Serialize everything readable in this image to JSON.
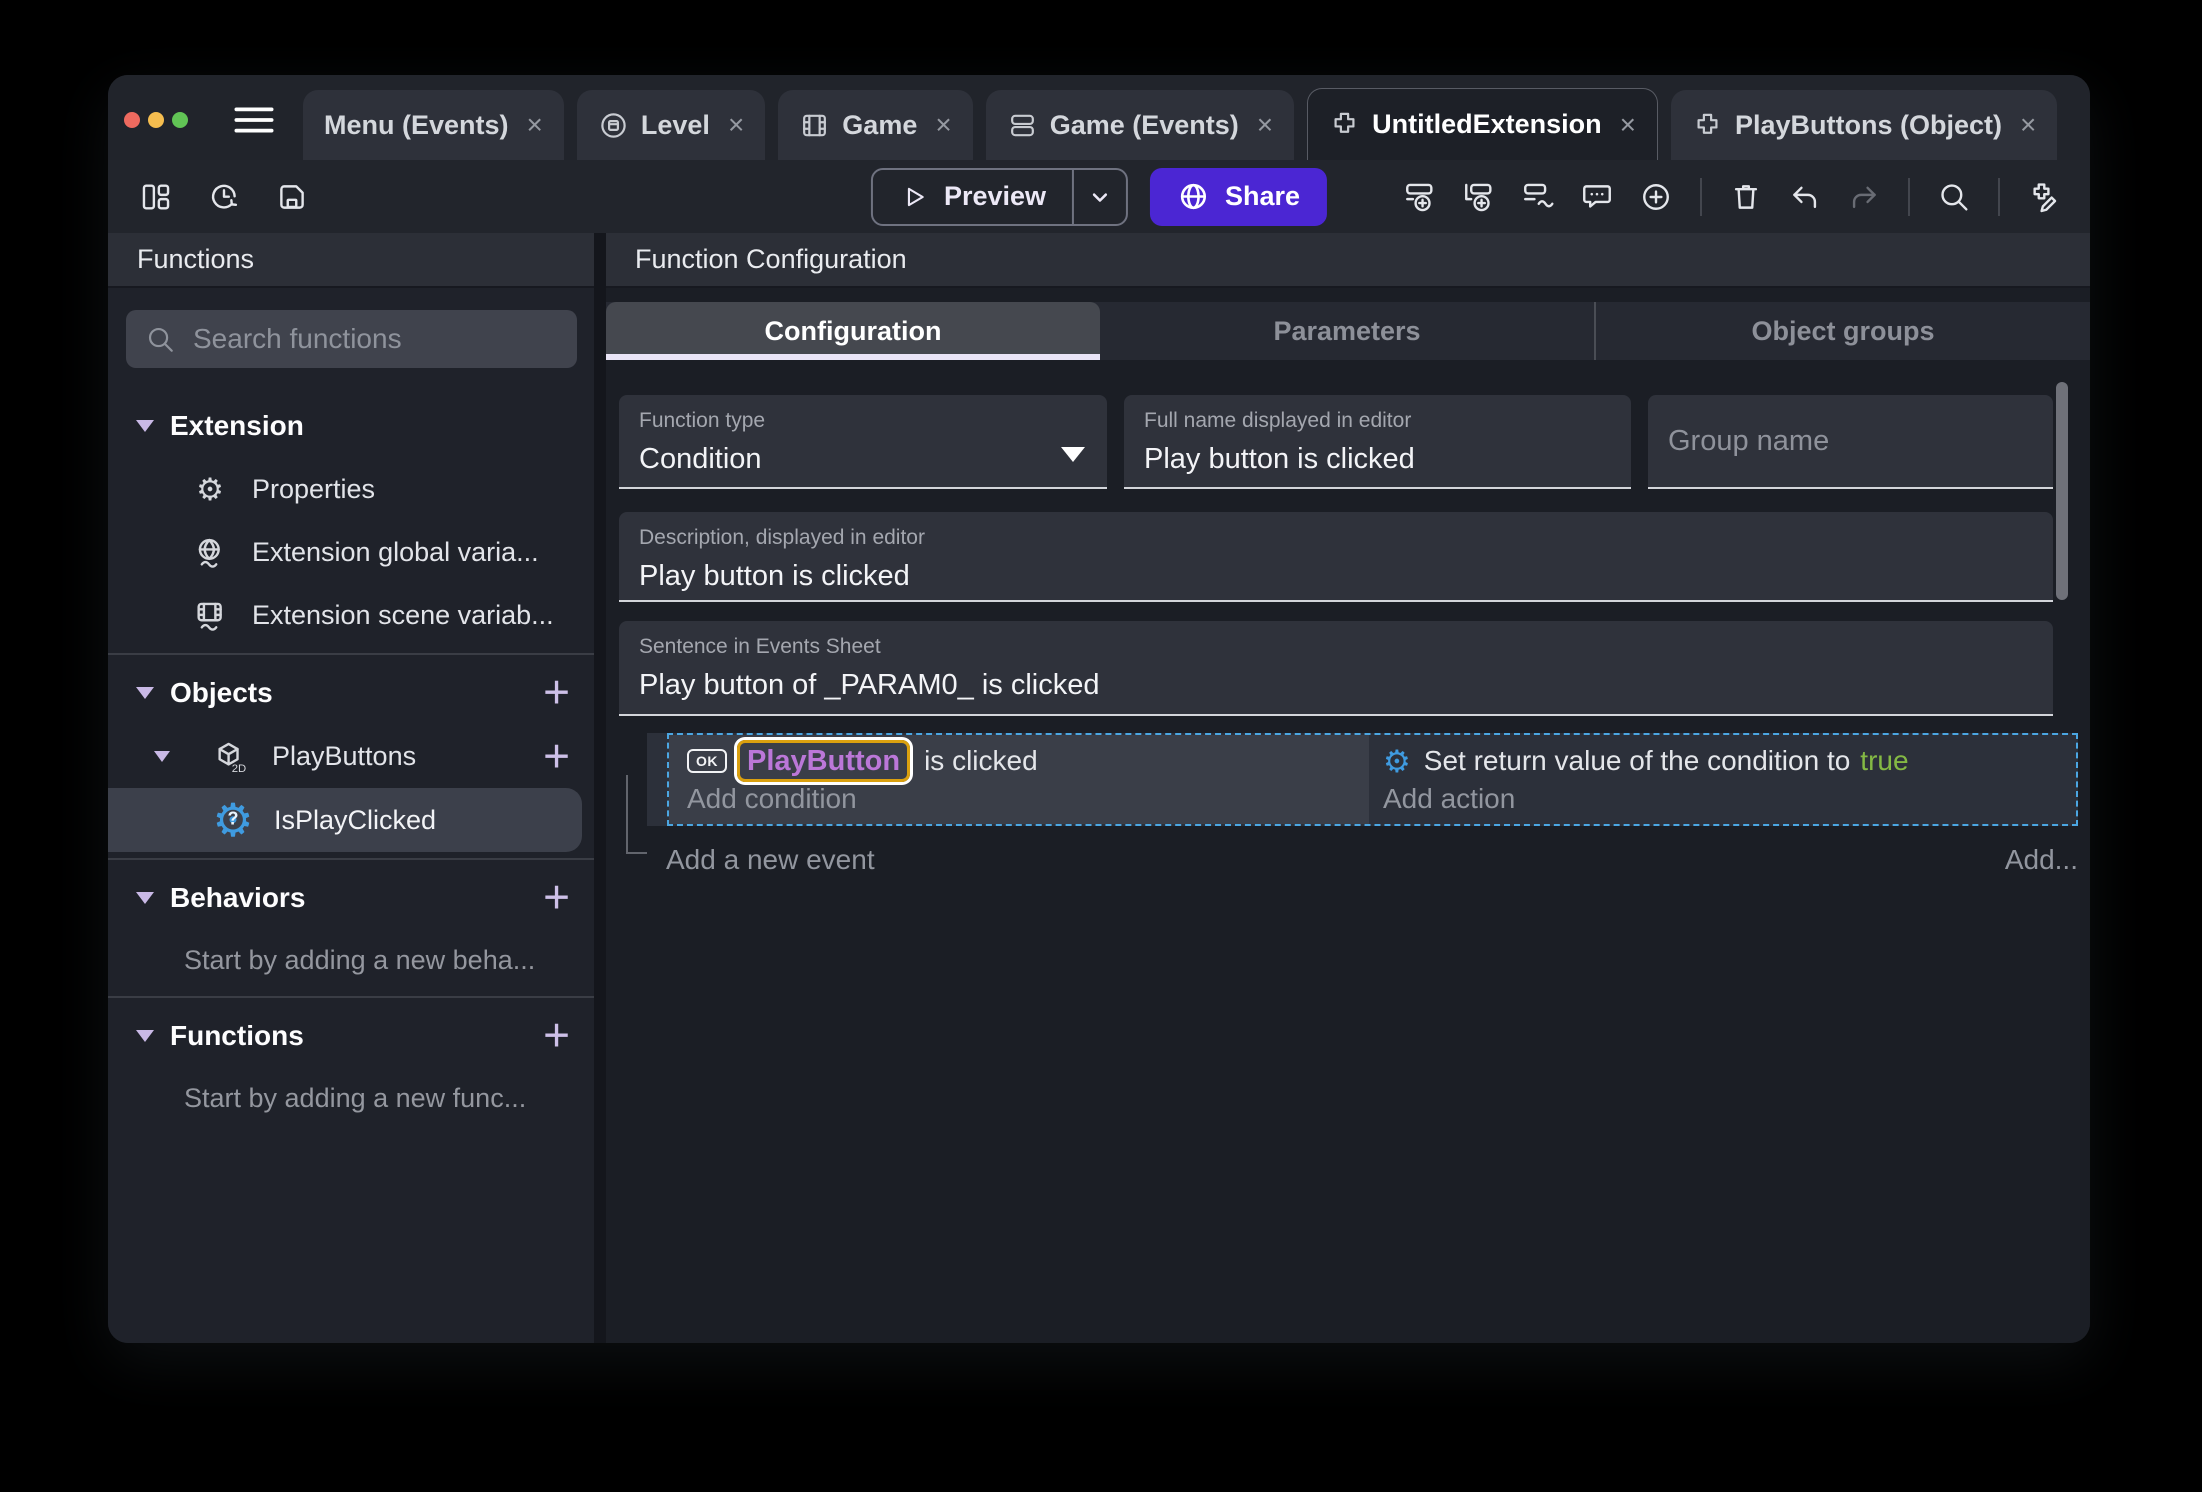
{
  "colors": {
    "accent_purple": "#4b26d3",
    "selection_blue": "#4ba6e2",
    "object_chip_text": "#bb77d8",
    "object_chip_border": "#daa00f",
    "true_green": "#84b944",
    "traffic_red": "#ee6a5f",
    "traffic_yellow": "#f5bd4f",
    "traffic_green": "#61c455"
  },
  "icons": {
    "gear_glyph": "⚙",
    "function_icon_glyph": "?"
  },
  "titlebar": {
    "close_glyph": "×",
    "tabs": [
      {
        "label": "Menu (Events)",
        "icon": null,
        "active": false
      },
      {
        "label": "Level",
        "icon": "scene-icon",
        "active": false
      },
      {
        "label": "Game",
        "icon": "video-icon",
        "active": false
      },
      {
        "label": "Game (Events)",
        "icon": "events-sheet-icon",
        "active": false
      },
      {
        "label": "UntitledExtension",
        "icon": "extension-icon",
        "active": true
      },
      {
        "label": "PlayButtons (Object)",
        "icon": "extension-icon",
        "active": false
      }
    ]
  },
  "toolbar": {
    "left_icons": [
      "panels-icon",
      "history-icon",
      "save-icon"
    ],
    "preview": {
      "label": "Preview"
    },
    "share": {
      "label": "Share"
    },
    "right_icons": [
      "add-event-icon",
      "add-subevent-icon",
      "add-other-event-icon",
      "comment-icon",
      "circle-plus-icon",
      "trash-icon",
      "undo-icon",
      "redo-icon",
      "search-icon",
      "edit-extension-icon"
    ]
  },
  "sidebar": {
    "title": "Functions",
    "search_placeholder": "Search functions",
    "sections": {
      "extension": {
        "label": "Extension",
        "items": [
          {
            "label": "Properties",
            "icon": "gear-icon"
          },
          {
            "label": "Extension global varia...",
            "icon": "global-variables-icon"
          },
          {
            "label": "Extension scene variab...",
            "icon": "scene-variables-icon"
          }
        ]
      },
      "objects": {
        "label": "Objects",
        "add_label": "+",
        "object": {
          "label": "PlayButtons",
          "badge": "2D",
          "add_label": "+",
          "function": {
            "label": "IsPlayClicked",
            "icon": "function-gear-icon"
          }
        }
      },
      "behaviors": {
        "label": "Behaviors",
        "add_label": "+",
        "hint": "Start by adding a new beha..."
      },
      "functions": {
        "label": "Functions",
        "add_label": "+",
        "hint": "Start by adding a new func..."
      }
    }
  },
  "main": {
    "title": "Function Configuration",
    "tabs": [
      {
        "label": "Configuration",
        "active": true
      },
      {
        "label": "Parameters",
        "active": false
      },
      {
        "label": "Object groups",
        "active": false
      }
    ],
    "form": {
      "function_type": {
        "label": "Function type",
        "value": "Condition"
      },
      "full_name": {
        "label": "Full name displayed in editor",
        "value": "Play button is clicked"
      },
      "group_name": {
        "placeholder": "Group name"
      },
      "description": {
        "label": "Description, displayed in editor",
        "value": "Play button is clicked"
      },
      "sentence": {
        "label": "Sentence in Events Sheet",
        "value": "Play button of _PARAM0_ is clicked"
      }
    },
    "events": {
      "condition": {
        "object_icon_label": "OK",
        "object_name": "PlayButton",
        "text": "is clicked",
        "add_label": "Add condition"
      },
      "action": {
        "text": "Set return value of the condition to",
        "value": "true",
        "add_label": "Add action"
      },
      "add_new_event_label": "Add a new event",
      "add_more_label": "Add..."
    }
  }
}
